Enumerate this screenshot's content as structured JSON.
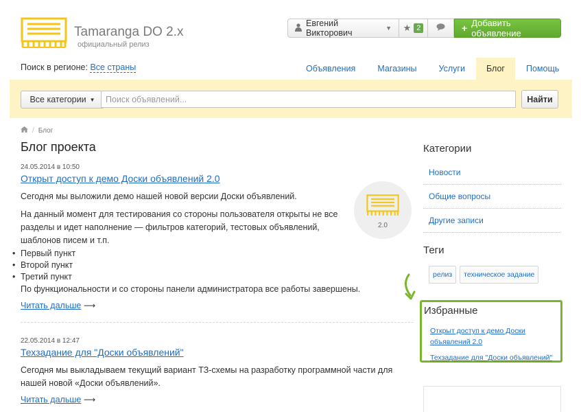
{
  "header": {
    "brand_name": "Tamaranga DO 2.x",
    "brand_subtitle": "официальный релиз",
    "user_name": "Евгений Викторович",
    "favorites_count": "2",
    "add_listing_label": "Добавить объявление",
    "brand_color": "#f5c518",
    "accent_green": "#6aa84f"
  },
  "region": {
    "label": "Поиск в регионе:",
    "value": "Все страны"
  },
  "nav": {
    "items": [
      "Объявления",
      "Магазины",
      "Услуги",
      "Блог",
      "Помощь"
    ],
    "active": "Блог"
  },
  "search": {
    "category_label": "Все категории",
    "placeholder": "Поиск объявлений...",
    "submit_label": "Найти"
  },
  "breadcrumb": {
    "current": "Блог"
  },
  "page_title": "Блог проекта",
  "posts": [
    {
      "date": "24.05.2014 в 10:50",
      "title": "Открыт доступ к демо Доски объявлений 2.0",
      "paragraphs": [
        "Сегодня мы выложили демо нашей новой версии Доски объявлений.",
        "На данный момент для тестирования со стороны пользователя открыты не все разделы и идет наполнение — фильтров категорий, тестовых объявлений, шаблонов писем и т.п."
      ],
      "bullets": [
        "Первый пункт",
        "Второй пункт",
        "Третий пункт"
      ],
      "after_bullets": "По функциональности и со стороны панели администратора все работы завершены.",
      "read_more": "Читать дальше",
      "thumb_label": "2.0"
    },
    {
      "date": "22.05.2014 в 12:47",
      "title": "Техзадание для \"Доски объявлений\"",
      "paragraphs": [
        "Сегодня мы выкладываем текущий вариант ТЗ-схемы на разработку программной части для нашей новой «Доски объявлений»."
      ],
      "read_more": "Читать дальше"
    }
  ],
  "sidebar": {
    "categories_title": "Категории",
    "categories": [
      "Новости",
      "Общие вопросы",
      "Другие записи"
    ],
    "tags_title": "Теги",
    "tags": [
      "релиз",
      "техническое задание"
    ],
    "favorites_title": "Избранные",
    "favorites": [
      "Открыт доступ к демо Доски объявлений 2.0",
      "Техзадание для \"Доски объявлений\""
    ],
    "highlight_color": "#7ab52e"
  }
}
